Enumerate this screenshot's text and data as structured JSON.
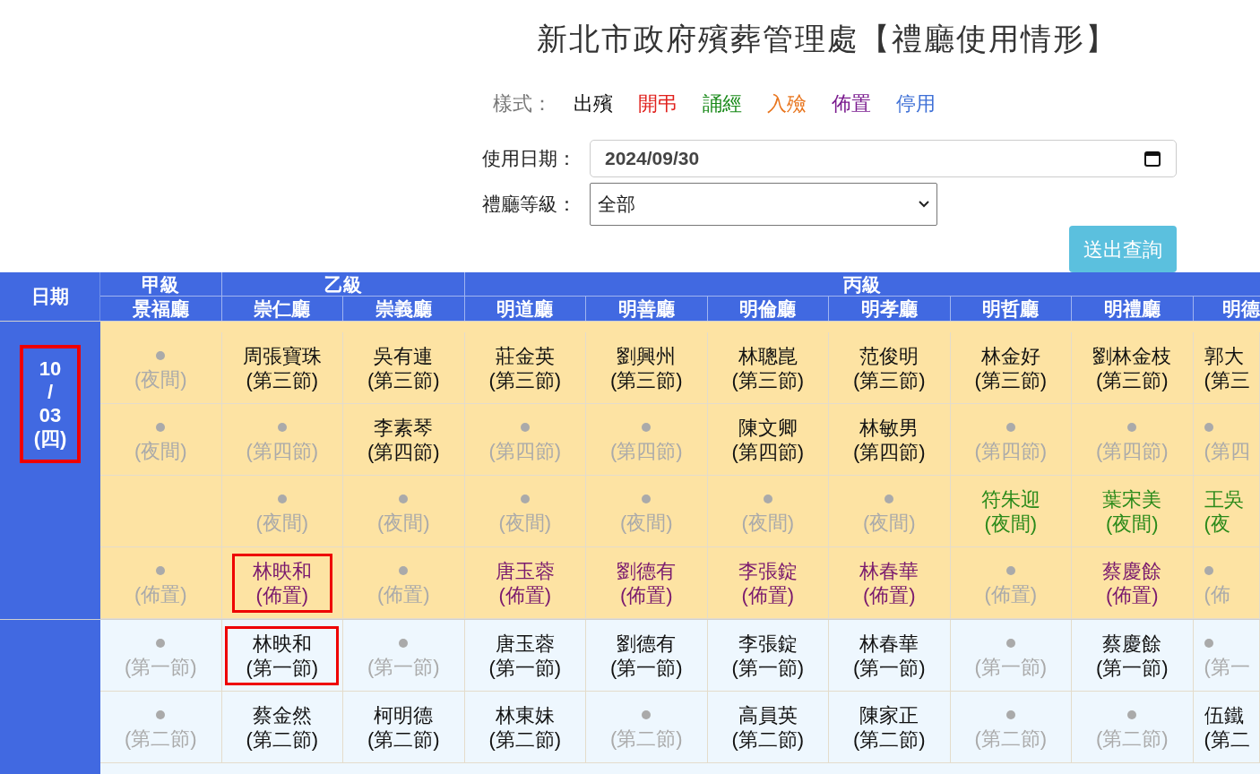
{
  "title": "新北市政府殯葬管理處【禮廳使用情形】",
  "legend": {
    "label": "樣式：",
    "items": [
      {
        "label": "出殯",
        "kind": "funeral"
      },
      {
        "label": "開弔",
        "kind": "wake"
      },
      {
        "label": "誦經",
        "kind": "chant"
      },
      {
        "label": "入殮",
        "kind": "encoffin"
      },
      {
        "label": "佈置",
        "kind": "setup"
      },
      {
        "label": "停用",
        "kind": "closed"
      }
    ]
  },
  "form": {
    "date_label": "使用日期：",
    "date_value": "2024/09/30",
    "level_label": "禮廳等級：",
    "level_value": "全部",
    "submit": "送出查詢"
  },
  "table": {
    "date_header": "日期",
    "groups": [
      "甲級",
      "乙級",
      "丙級"
    ],
    "halls": [
      "景福廳",
      "崇仁廳",
      "崇義廳",
      "明道廳",
      "明善廳",
      "明倫廳",
      "明孝廳",
      "明哲廳",
      "明禮廳",
      "明德"
    ],
    "days": [
      {
        "date": [
          "10",
          "/",
          "03",
          "(四)"
        ],
        "highlighted": true,
        "rows": [
          [
            {
              "kind": "empty",
              "slot": "(夜間)"
            },
            {
              "kind": "funeral",
              "name": "周張寶珠",
              "slot": "(第三節)"
            },
            {
              "kind": "funeral",
              "name": "吳有連",
              "slot": "(第三節)"
            },
            {
              "kind": "funeral",
              "name": "莊金英",
              "slot": "(第三節)"
            },
            {
              "kind": "funeral",
              "name": "劉興州",
              "slot": "(第三節)"
            },
            {
              "kind": "funeral",
              "name": "林聰崑",
              "slot": "(第三節)"
            },
            {
              "kind": "funeral",
              "name": "范俊明",
              "slot": "(第三節)"
            },
            {
              "kind": "funeral",
              "name": "林金好",
              "slot": "(第三節)"
            },
            {
              "kind": "funeral",
              "name": "劉林金枝",
              "slot": "(第三節)"
            },
            {
              "kind": "funeral",
              "name": "郭大",
              "slot": "(第三"
            }
          ],
          [
            {
              "kind": "empty",
              "slot": "(夜間)"
            },
            {
              "kind": "empty",
              "slot": "(第四節)"
            },
            {
              "kind": "funeral",
              "name": "李素琴",
              "slot": "(第四節)"
            },
            {
              "kind": "empty",
              "slot": "(第四節)"
            },
            {
              "kind": "empty",
              "slot": "(第四節)"
            },
            {
              "kind": "funeral",
              "name": "陳文卿",
              "slot": "(第四節)"
            },
            {
              "kind": "funeral",
              "name": "林敏男",
              "slot": "(第四節)"
            },
            {
              "kind": "empty",
              "slot": "(第四節)"
            },
            {
              "kind": "empty",
              "slot": "(第四節)"
            },
            {
              "kind": "empty",
              "slot": "(第四"
            }
          ],
          [
            {
              "kind": "blank"
            },
            {
              "kind": "empty",
              "slot": "(夜間)"
            },
            {
              "kind": "empty",
              "slot": "(夜間)"
            },
            {
              "kind": "empty",
              "slot": "(夜間)"
            },
            {
              "kind": "empty",
              "slot": "(夜間)"
            },
            {
              "kind": "empty",
              "slot": "(夜間)"
            },
            {
              "kind": "empty",
              "slot": "(夜間)"
            },
            {
              "kind": "chant",
              "name": "符朱迎",
              "slot": "(夜間)"
            },
            {
              "kind": "chant",
              "name": "葉宋美",
              "slot": "(夜間)"
            },
            {
              "kind": "chant",
              "name": "王吳",
              "slot": "(夜"
            }
          ],
          [
            {
              "kind": "empty",
              "slot": "(佈置)"
            },
            {
              "kind": "setup",
              "name": "林映和",
              "slot": "(佈置)",
              "highlighted": true
            },
            {
              "kind": "empty",
              "slot": "(佈置)"
            },
            {
              "kind": "setup",
              "name": "唐玉蓉",
              "slot": "(佈置)"
            },
            {
              "kind": "setup",
              "name": "劉德有",
              "slot": "(佈置)"
            },
            {
              "kind": "setup",
              "name": "李張錠",
              "slot": "(佈置)"
            },
            {
              "kind": "setup",
              "name": "林春華",
              "slot": "(佈置)"
            },
            {
              "kind": "empty",
              "slot": "(佈置)"
            },
            {
              "kind": "setup",
              "name": "蔡慶餘",
              "slot": "(佈置)"
            },
            {
              "kind": "empty",
              "slot": "(佈"
            }
          ]
        ]
      },
      {
        "highlighted": false,
        "rows": [
          [
            {
              "kind": "empty",
              "slot": "(第一節)"
            },
            {
              "kind": "funeral",
              "name": "林映和",
              "slot": "(第一節)",
              "highlighted": true
            },
            {
              "kind": "empty",
              "slot": "(第一節)"
            },
            {
              "kind": "funeral",
              "name": "唐玉蓉",
              "slot": "(第一節)"
            },
            {
              "kind": "funeral",
              "name": "劉德有",
              "slot": "(第一節)"
            },
            {
              "kind": "funeral",
              "name": "李張錠",
              "slot": "(第一節)"
            },
            {
              "kind": "funeral",
              "name": "林春華",
              "slot": "(第一節)"
            },
            {
              "kind": "empty",
              "slot": "(第一節)"
            },
            {
              "kind": "funeral",
              "name": "蔡慶餘",
              "slot": "(第一節)"
            },
            {
              "kind": "empty",
              "slot": "(第一"
            }
          ],
          [
            {
              "kind": "empty",
              "slot": "(第二節)"
            },
            {
              "kind": "funeral",
              "name": "蔡金然",
              "slot": "(第二節)"
            },
            {
              "kind": "funeral",
              "name": "柯明德",
              "slot": "(第二節)"
            },
            {
              "kind": "funeral",
              "name": "林東妹",
              "slot": "(第二節)"
            },
            {
              "kind": "empty",
              "slot": "(第二節)"
            },
            {
              "kind": "funeral",
              "name": "高員英",
              "slot": "(第二節)"
            },
            {
              "kind": "funeral",
              "name": "陳家正",
              "slot": "(第二節)"
            },
            {
              "kind": "empty",
              "slot": "(第二節)"
            },
            {
              "kind": "empty",
              "slot": "(第二節)"
            },
            {
              "kind": "funeral",
              "name": "伍鐵",
              "slot": "(第二"
            }
          ]
        ]
      }
    ]
  }
}
